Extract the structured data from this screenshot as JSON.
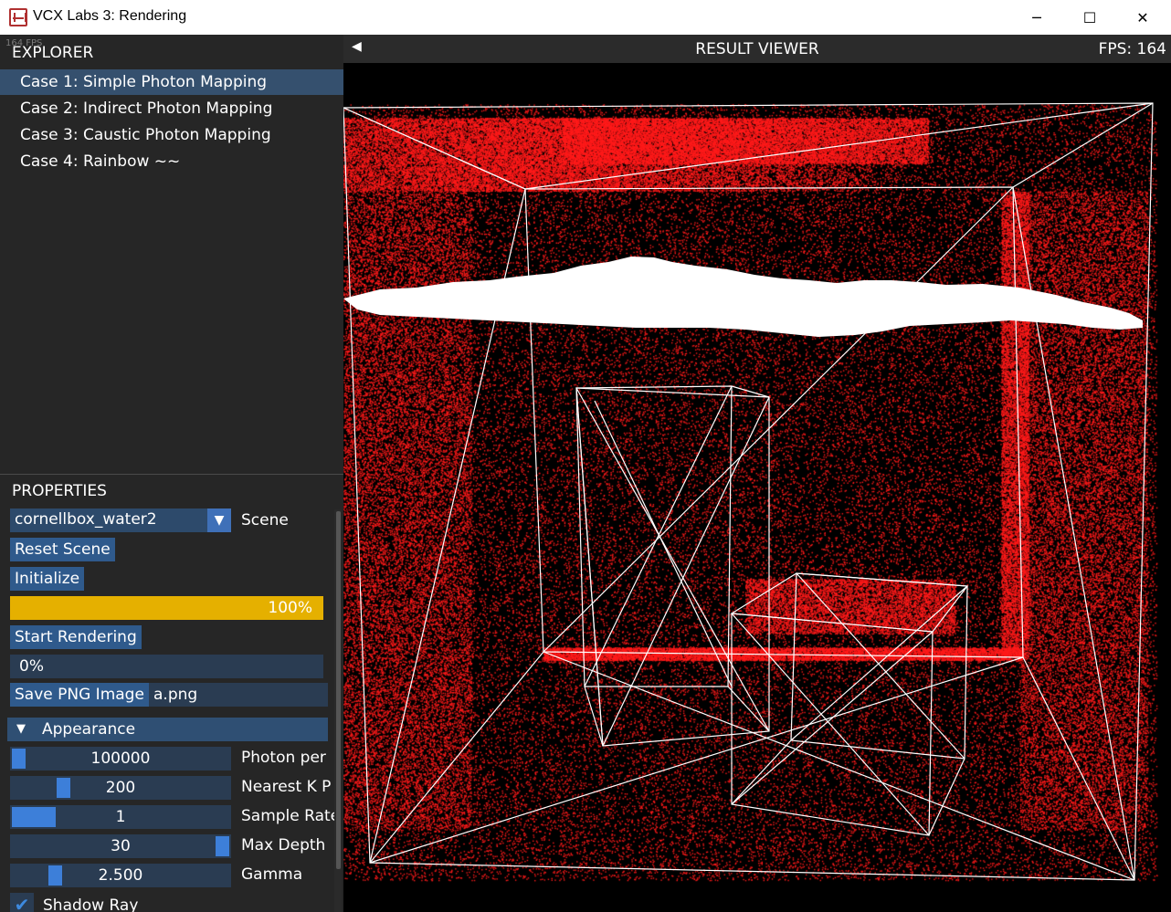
{
  "window": {
    "title": "VCX Labs 3: Rendering",
    "minimize_icon": "minimize-icon",
    "maximize_icon": "maximize-icon",
    "close_icon": "close-icon"
  },
  "explorer": {
    "fps_overlay": "164 FPS",
    "header": "EXPLORER",
    "cases": [
      {
        "label": "Case 1: Simple Photon Mapping",
        "selected": true
      },
      {
        "label": "Case 2: Indirect Photon Mapping",
        "selected": false
      },
      {
        "label": "Case 3: Caustic Photon Mapping",
        "selected": false
      },
      {
        "label": "Case 4: Rainbow ~~",
        "selected": false
      }
    ]
  },
  "properties": {
    "header": "PROPERTIES",
    "scene": {
      "value": "cornellbox_water2",
      "label": "Scene"
    },
    "reset_label": "Reset Scene",
    "initialize_label": "Initialize",
    "init_progress": {
      "value": 1.0,
      "text": "100%"
    },
    "start_label": "Start Rendering",
    "render_progress": {
      "value": 0.0,
      "text": "0%"
    },
    "save_label": "Save PNG Image",
    "filename": "a.png",
    "appearance_header": "Appearance",
    "sliders": [
      {
        "value": "100000",
        "label": "Photon per",
        "level": 0.0
      },
      {
        "value": "200",
        "label": "Nearest K P",
        "level": 0.22
      },
      {
        "value": "1",
        "label": "Sample Rate",
        "level": 0.0
      },
      {
        "value": "30",
        "label": "Max Depth",
        "level": 1.0
      },
      {
        "value": "2.500",
        "label": "Gamma",
        "level": 0.18
      }
    ],
    "shadow_ray": {
      "label": "Shadow Ray",
      "checked": true
    }
  },
  "viewer": {
    "title": "RESULT VIEWER",
    "fps": "FPS:  164",
    "accent_red": "#ff1a1a"
  },
  "colors": {
    "selected_bg": "#35506e",
    "button_bg": "#2f5a8c",
    "progress_fill": "#e5b000",
    "slider_grab": "#3d7fd9"
  }
}
